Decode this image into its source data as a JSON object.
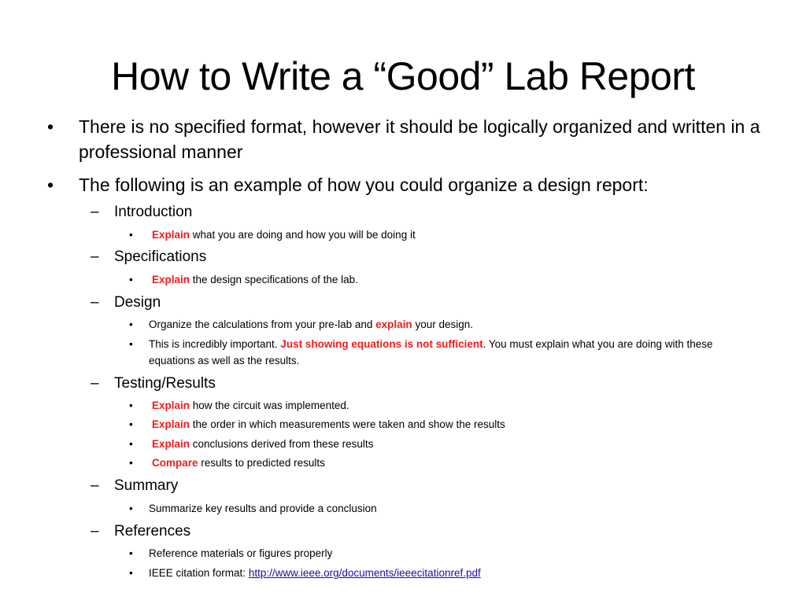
{
  "slide": {
    "title": "How to Write a “Good” Lab Report",
    "bullets": [
      {
        "text": "There is no specified format, however it should be logically organized and written in a professional manner"
      },
      {
        "text": "The following is an example of how you could organize a design report:"
      }
    ],
    "sections": [
      {
        "heading": "Introduction",
        "items": [
          {
            "em": "Explain",
            "rest": " what you are doing and how you will be doing it"
          }
        ]
      },
      {
        "heading": "Specifications",
        "items": [
          {
            "em": "Explain",
            "rest": " the design specifications of the lab."
          }
        ]
      },
      {
        "heading": "Design",
        "items": [
          {
            "pre": "Organize the calculations from your pre-lab and ",
            "em": "explain",
            "rest": " your design."
          },
          {
            "pre": "This is incredibly important. ",
            "em": "Just showing equations is not sufficient",
            "rest": ". You must explain what you are doing with these equations as well as the results."
          }
        ]
      },
      {
        "heading": "Testing/Results",
        "items": [
          {
            "em": "Explain",
            "rest": " how the circuit was implemented."
          },
          {
            "em": "Explain",
            "rest": " the order in which measurements were taken and show the results"
          },
          {
            "em": "Explain",
            "rest": " conclusions derived from these results"
          },
          {
            "em": "Compare",
            "rest": " results to predicted results"
          }
        ]
      },
      {
        "heading": "Summary",
        "items": [
          {
            "rest": "Summarize key results and provide a conclusion"
          }
        ]
      },
      {
        "heading": "References",
        "items": [
          {
            "rest": "Reference materials or figures properly"
          },
          {
            "pre": "IEEE citation format: ",
            "link": "http://www.ieee.org/documents/ieeecitationref.pdf"
          }
        ]
      }
    ],
    "glyphs": {
      "bullet": "•",
      "dash": "–"
    },
    "colors": {
      "emphasis": "#ee1c1c",
      "link": "#1a0dab"
    }
  }
}
